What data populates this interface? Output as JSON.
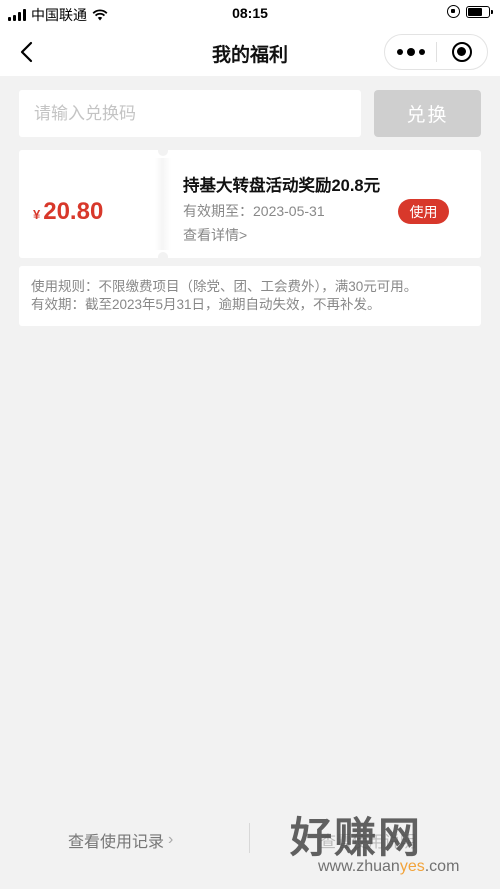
{
  "status_bar": {
    "carrier": "中国联通",
    "time": "08:15"
  },
  "nav": {
    "title": "我的福利"
  },
  "redeem": {
    "placeholder": "请输入兑换码",
    "button_label": "兑换"
  },
  "coupon": {
    "currency_symbol": "¥",
    "amount": "20.80",
    "title": "持基大转盘活动奖励20.8元",
    "expiry_label": "有效期至：",
    "expiry_date": "2023-05-31",
    "details_link": "查看详情>",
    "use_button": "使用"
  },
  "rules": {
    "line1": "使用规则：不限缴费项目（除党、团、工会费外），满30元可用。",
    "line2": "有效期：截至2023年5月31日，逾期自动失效，不再补发。"
  },
  "footer": {
    "records_link": "查看使用记录",
    "records_chevron": "›",
    "second_link": "查看使用说明"
  },
  "watermark": {
    "big": "好赚网",
    "small_prefix": "www.zhuan",
    "small_highlight": "yes",
    "small_suffix": ".com"
  },
  "colors": {
    "accent_red": "#d8382b",
    "page_bg": "#f2f2f2",
    "disabled_button": "#cfcfcf"
  },
  "icons": [
    "signal-icon",
    "wifi-icon",
    "lock-rotation-icon",
    "battery-icon",
    "back-arrow-icon",
    "more-dots-icon",
    "close-target-icon"
  ]
}
